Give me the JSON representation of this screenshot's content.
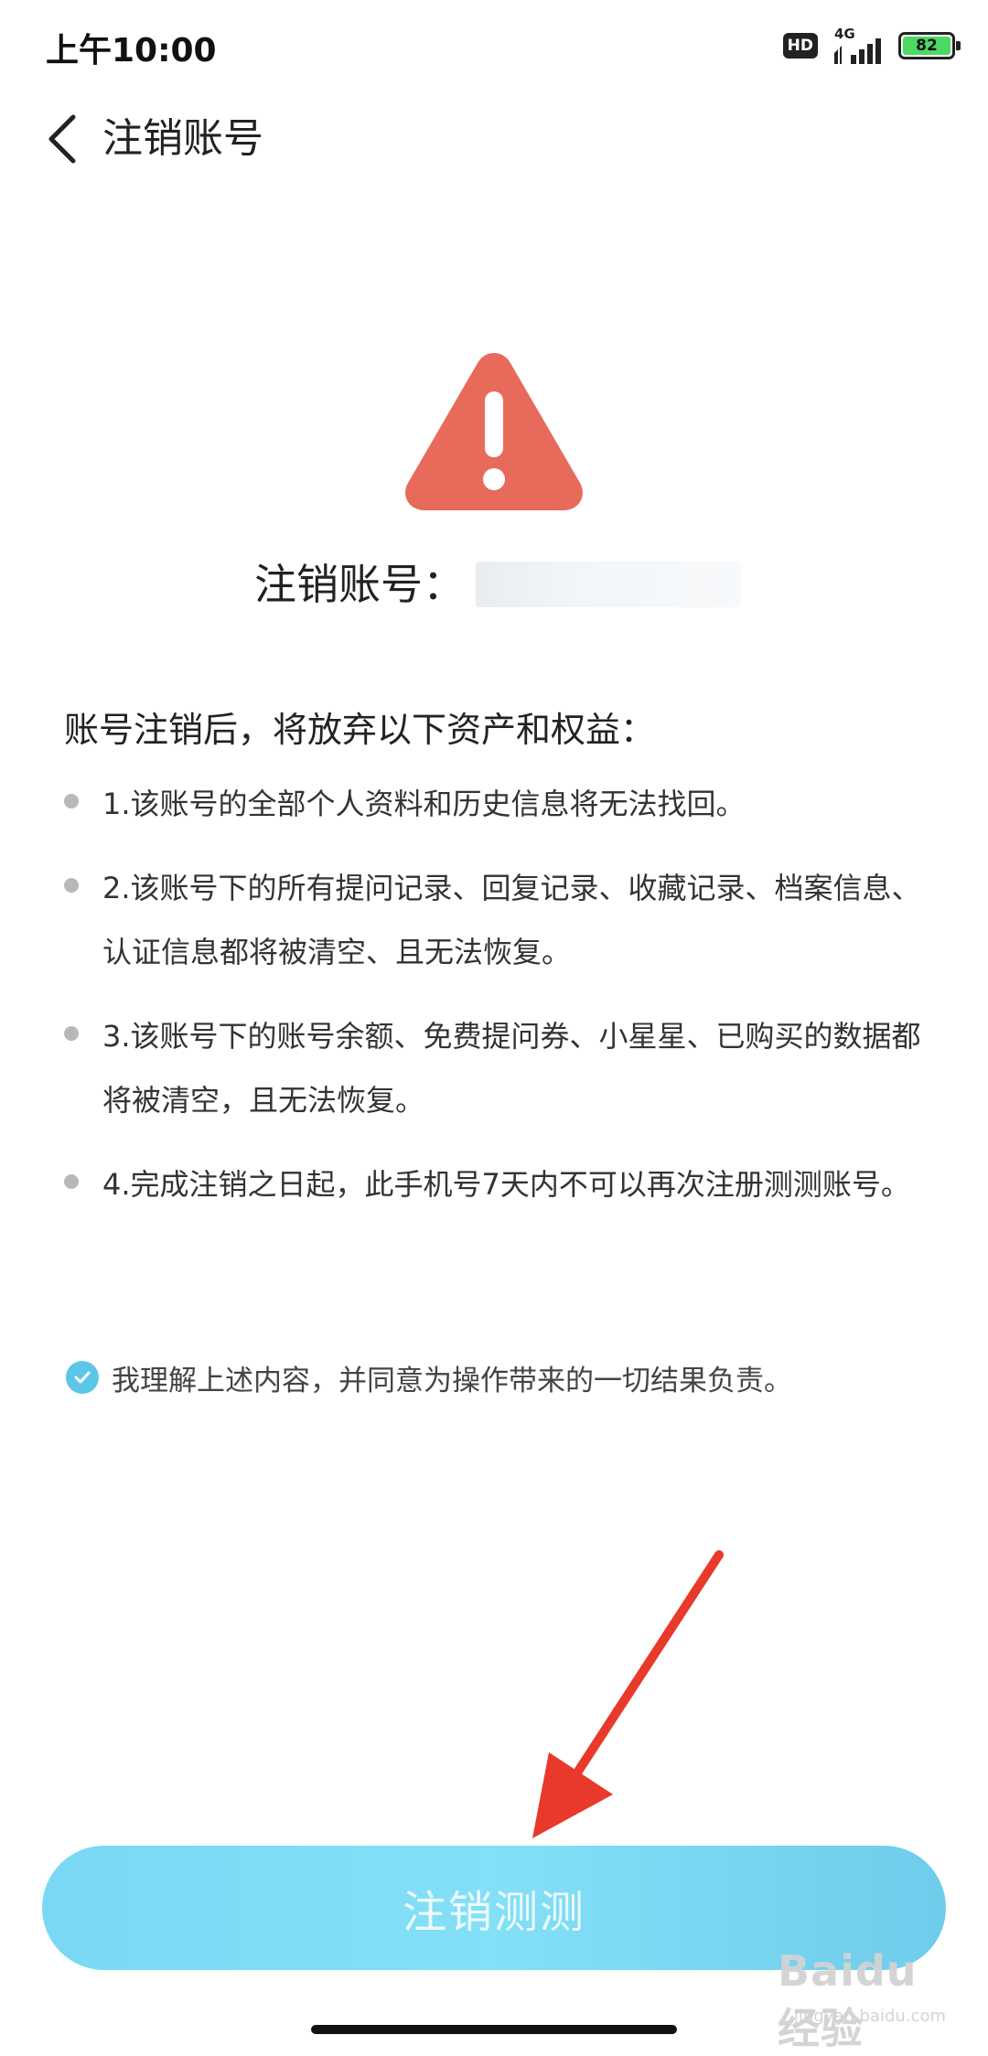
{
  "status_bar": {
    "time": "上午10:00",
    "hd": "HD",
    "network": "4G",
    "battery": "82"
  },
  "nav": {
    "title": "注销账号"
  },
  "warning": {
    "account_label": "注销账号："
  },
  "content": {
    "lead": "账号注销后，将放弃以下资产和权益：",
    "terms": [
      "1.该账号的全部个人资料和历史信息将无法找回。",
      "2.该账号下的所有提问记录、回复记录、收藏记录、档案信息、认证信息都将被清空、且无法恢复。",
      "3.该账号下的账号余额、免费提问券、小星星、已购买的数据都将被清空，且无法恢复。",
      "4.完成注销之日起，此手机号7天内不可以再次注册测测账号。"
    ]
  },
  "agreement": {
    "text": "我理解上述内容，并同意为操作带来的一切结果负责。",
    "checked": true
  },
  "action": {
    "button_label": "注销测测"
  },
  "watermark": {
    "main": "Baidu经验",
    "sub": "jingyan.baidu.com"
  },
  "colors": {
    "warning_red": "#e86a5b",
    "accent_cyan": "#7ad8f4",
    "check_cyan": "#5cc6e8",
    "arrow_red": "#e8392a"
  }
}
